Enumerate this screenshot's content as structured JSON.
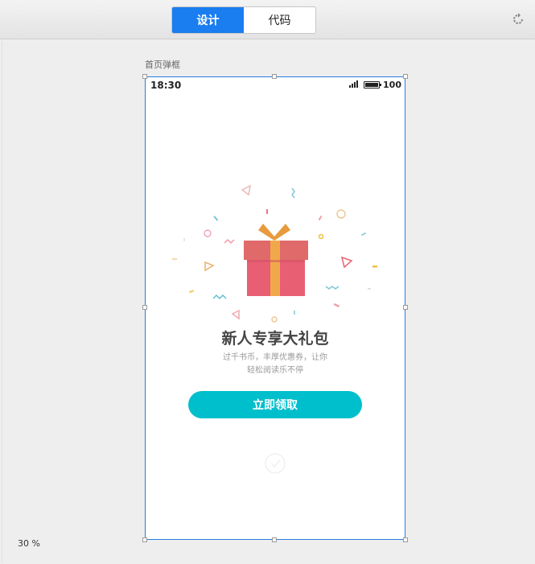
{
  "toolbar": {
    "tabs": [
      {
        "label": "设计",
        "active": true
      },
      {
        "label": "代码",
        "active": false
      }
    ],
    "refresh_icon": "refresh-icon"
  },
  "frame": {
    "label": "首页弹框",
    "status_bar": {
      "time": "18:30",
      "battery": "100",
      "signal_icon": "signal-icon",
      "battery_icon": "battery-icon"
    },
    "popup": {
      "gift_icon": "gift-icon",
      "title": "新人专享大礼包",
      "desc_line1": "过千书币，丰厚优惠券，让你",
      "desc_line2": "轻松阅读乐不停",
      "button_label": "立即领取",
      "button_color": "#00bfcc",
      "close_icon": "close-circle-icon"
    }
  },
  "zoom": "30 %",
  "colors": {
    "accent": "#1a7df0",
    "gift_box": "#e4606d",
    "gift_ribbon": "#f0a94a",
    "selection": "#2a7de1"
  }
}
